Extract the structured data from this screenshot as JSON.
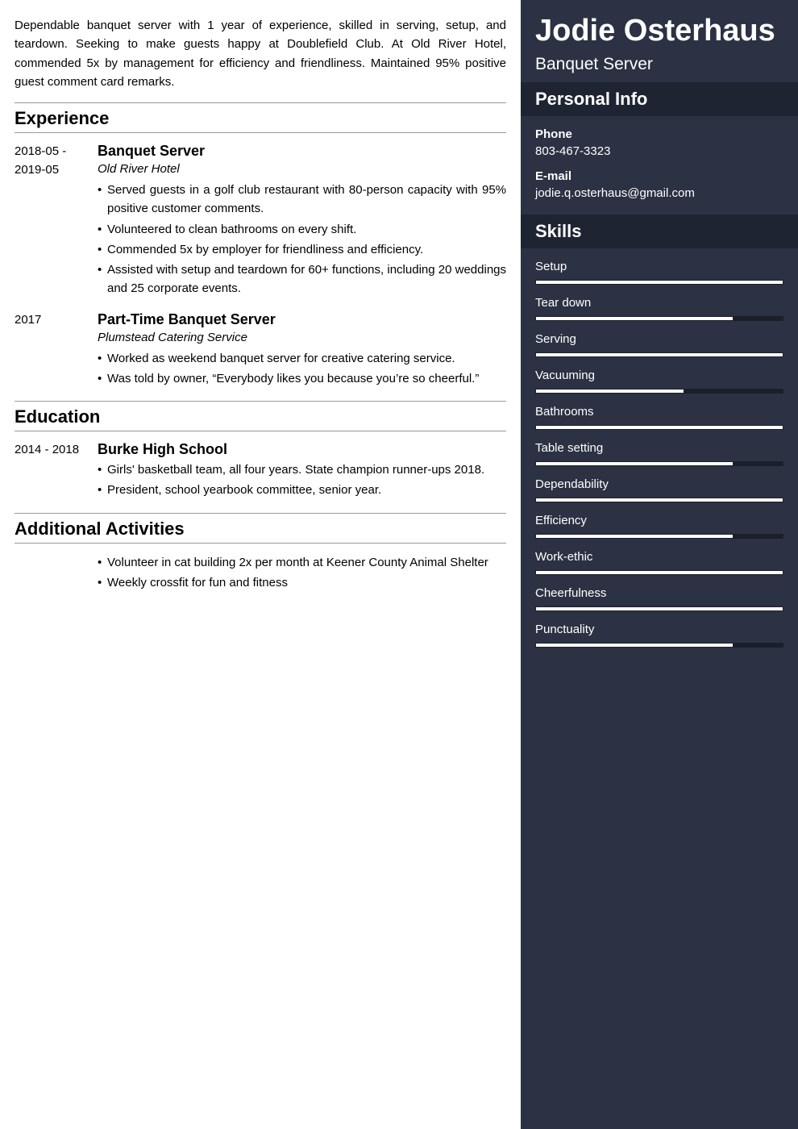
{
  "summary": "Dependable banquet server with 1 year of experience, skilled in serving, setup, and teardown. Seeking to make guests happy at Doublefield Club. At Old River Hotel, commended 5x by management for efficiency and friendliness. Maintained 95% positive guest comment card remarks.",
  "sections": {
    "experience_title": "Experience",
    "education_title": "Education",
    "activities_title": "Additional Activities"
  },
  "experience": [
    {
      "dates": "2018-05 - 2019-05",
      "title": "Banquet Server",
      "sub": "Old River Hotel",
      "bullets": [
        "Served guests in a golf club restaurant with 80-person capacity with 95% positive customer comments.",
        "Volunteered to clean bathrooms on every shift.",
        "Commended 5x by employer for friendliness and efficiency.",
        "Assisted with setup and teardown for 60+ functions, including 20 weddings and 25 corporate events."
      ]
    },
    {
      "dates": "2017",
      "title": "Part-Time Banquet Server",
      "sub": "Plumstead Catering Service",
      "bullets": [
        "Worked as weekend banquet server for creative catering service.",
        "Was told by owner, “Everybody likes you because you’re so cheerful.”"
      ]
    }
  ],
  "education": [
    {
      "dates": "2014 - 2018",
      "title": "Burke High School",
      "bullets": [
        "Girls' basketball team, all four years. State champion runner-ups 2018.",
        "President, school yearbook committee, senior year."
      ]
    }
  ],
  "activities": {
    "bullets": [
      "Volunteer in cat building 2x per month at Keener County Animal Shelter",
      "Weekly crossfit for fun and fitness"
    ]
  },
  "sidebar": {
    "name": "Jodie Osterhaus",
    "job": "Banquet Server",
    "personal_info_title": "Personal Info",
    "phone_label": "Phone",
    "phone": "803-467-3323",
    "email_label": "E-mail",
    "email": "jodie.q.osterhaus@gmail.com",
    "skills_title": "Skills",
    "skills": [
      {
        "label": "Setup",
        "level": 100
      },
      {
        "label": "Tear down",
        "level": 80
      },
      {
        "label": "Serving",
        "level": 100
      },
      {
        "label": "Vacuuming",
        "level": 60
      },
      {
        "label": "Bathrooms",
        "level": 100
      },
      {
        "label": "Table setting",
        "level": 80
      },
      {
        "label": "Dependability",
        "level": 100
      },
      {
        "label": "Efficiency",
        "level": 80
      },
      {
        "label": "Work-ethic",
        "level": 100
      },
      {
        "label": "Cheerfulness",
        "level": 100
      },
      {
        "label": "Punctuality",
        "level": 80
      }
    ]
  }
}
